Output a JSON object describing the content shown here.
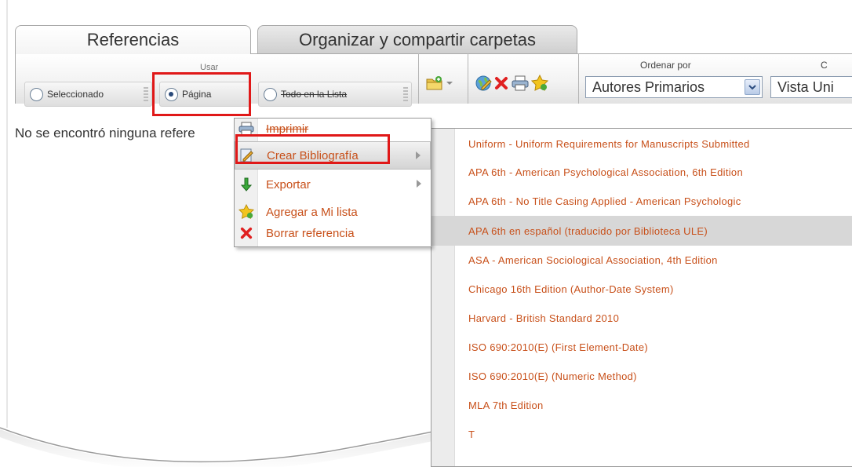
{
  "tabs": [
    {
      "label": "Referencias",
      "active": true
    },
    {
      "label": "Organizar y compartir carpetas",
      "active": false
    }
  ],
  "toolbar": {
    "usar_label": "Usar",
    "options": [
      {
        "label": "Seleccionado",
        "selected": false
      },
      {
        "label": "Página",
        "selected": true
      },
      {
        "label": "Todo en la Lista",
        "selected": false
      }
    ],
    "icons": [
      "folder-add-icon",
      "dropdown-arrow-icon",
      "globe-icon",
      "delete-icon",
      "print-icon",
      "star-add-icon"
    ],
    "ordenar_label": "Ordenar por",
    "sort_value": "Autores Primarios",
    "view_label": "C",
    "view_value": "Vista Uni"
  },
  "message": "No se encontró ninguna refere",
  "context_menu": {
    "items": [
      {
        "label": "Imprimir",
        "icon": "printer-icon",
        "submenu": false
      },
      {
        "label": "Crear Bibliografía",
        "icon": "pencil-doc-icon",
        "submenu": true,
        "highlighted": true
      },
      {
        "label": "Exportar",
        "icon": "green-down-arrow-icon",
        "submenu": true
      },
      {
        "label": "Agregar a Mi lista",
        "icon": "star-add-icon",
        "submenu": false
      },
      {
        "label": "Borrar referencia",
        "icon": "red-x-icon",
        "submenu": false
      }
    ]
  },
  "styles_submenu": {
    "items": [
      "Uniform - Uniform Requirements for Manuscripts Submitted",
      "APA 6th - American Psychological Association, 6th Edition",
      "APA 6th - No Title Casing Applied - American Psychologic",
      "APA 6th en español (traducido por Biblioteca ULE)",
      "ASA - American Sociological Association, 4th Edition",
      "Chicago 16th Edition (Author-Date System)",
      "Harvard - British Standard 2010",
      "ISO 690:2010(E) (First Element-Date)",
      "ISO 690:2010(E) (Numeric Method)",
      "MLA 7th Edition",
      "T"
    ],
    "highlighted_index": 3
  },
  "colors": {
    "highlight_red": "#e01818",
    "menu_text": "#c8501a"
  }
}
